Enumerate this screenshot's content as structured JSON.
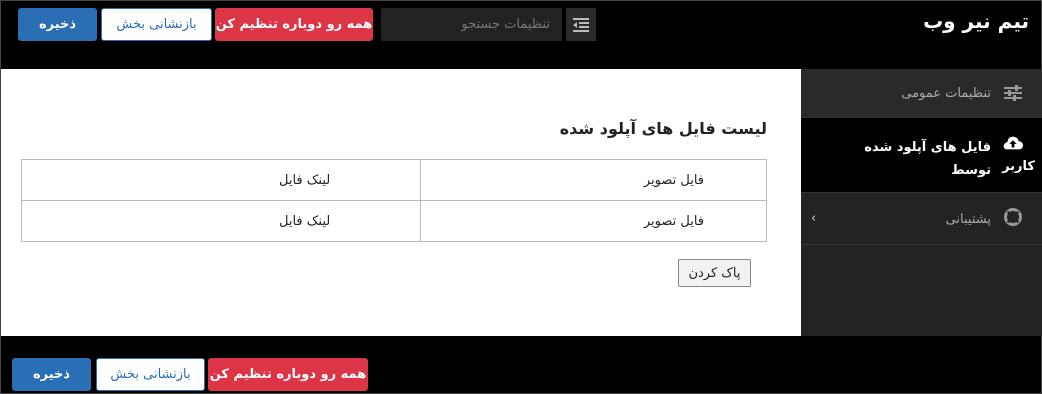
{
  "app": {
    "brand": "تیم نیر وب"
  },
  "toolbar": {
    "search_placeholder": "تنظیمات جستجو",
    "reset_all_label": "همه رو دوباره تنظیم کن",
    "reset_section_label": "بازنشانی بخش",
    "save_label": "ذخیره"
  },
  "sidebar": {
    "items": [
      {
        "label": "تنظیمات عمومی",
        "icon": "sliders-icon"
      },
      {
        "label": "فایل های آپلود شده توسط",
        "label_cont": "کاربر",
        "icon": "cloud-upload-icon",
        "active": true
      },
      {
        "label": "پشتیبانی",
        "icon": "lifebuoy-icon"
      }
    ]
  },
  "main": {
    "title": "لیست فایل های آپلود شده",
    "rows": [
      {
        "image": "فایل تصویر",
        "link": "لینک فایل"
      },
      {
        "image": "فایل تصویر",
        "link": "لینک فایل"
      }
    ],
    "clear_label": "پاک کردن"
  },
  "footer": {
    "reset_all_label": "همه رو دوباره تنظیم کن",
    "reset_section_label": "بازنشانی بخش",
    "save_label": "ذخیره"
  },
  "colors": {
    "danger": "#dc3545",
    "primary": "#2a6fb5",
    "background": "#000000",
    "panel": "#ffffff"
  }
}
